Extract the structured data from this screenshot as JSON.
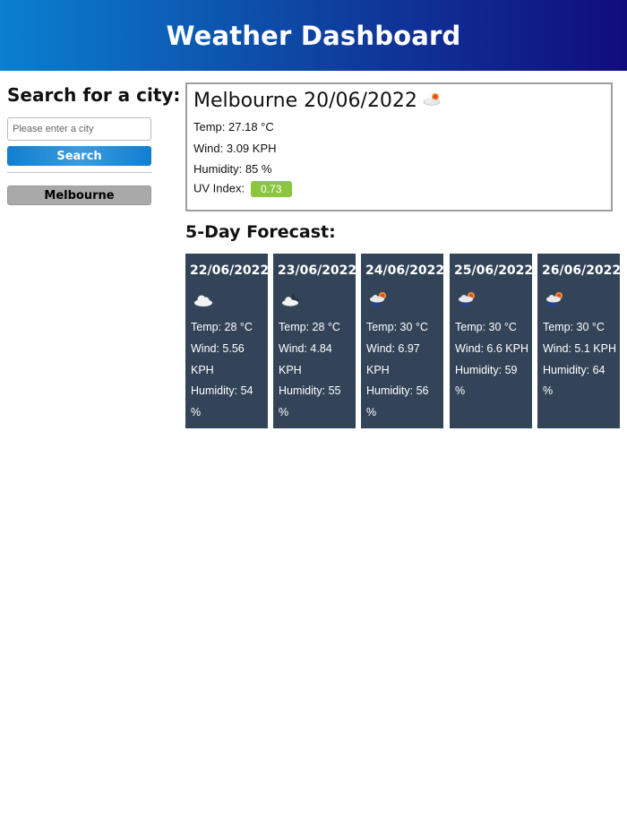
{
  "header": {
    "title": "Weather Dashboard"
  },
  "search": {
    "title": "Search for a city:",
    "placeholder": "Please enter a city",
    "value": "",
    "button_label": "Search"
  },
  "history": [
    {
      "label": "Melbourne"
    }
  ],
  "current": {
    "city_date": "Melbourne 20/06/2022",
    "icon": "partly-cloudy-sun-icon",
    "temp_label": "Temp:",
    "temp_value": "27.18 °C",
    "wind_label": "Wind:",
    "wind_value": "3.09 KPH",
    "humidity_label": "Humidity:",
    "humidity_value": "85 %",
    "uv_label": "UV Index:",
    "uv_value": "0.73",
    "uv_color": "#8cc63f"
  },
  "forecast": {
    "title": "5-Day Forecast:",
    "days": [
      {
        "date": "22/06/2022",
        "icon": "cloud-icon",
        "temp": "Temp: 28 °C",
        "wind": "Wind: 5.56 KPH",
        "humidity": "Humidity: 54 %"
      },
      {
        "date": "23/06/2022",
        "icon": "cloudy-night-icon",
        "temp": "Temp: 28 °C",
        "wind": "Wind: 4.84 KPH",
        "humidity": "Humidity: 55 %"
      },
      {
        "date": "24/06/2022",
        "icon": "rain-sun-icon",
        "temp": "Temp: 30 °C",
        "wind": "Wind: 6.97 KPH",
        "humidity": "Humidity: 56 %"
      },
      {
        "date": "25/06/2022",
        "icon": "rain-sun-icon",
        "temp": "Temp: 30 °C",
        "wind": "Wind: 6.6 KPH",
        "humidity": "Humidity: 59 %"
      },
      {
        "date": "26/06/2022",
        "icon": "rain-sun-icon",
        "temp": "Temp: 30 °C",
        "wind": "Wind: 5.1 KPH",
        "humidity": "Humidity: 64 %"
      }
    ]
  },
  "colors": {
    "header_gradient": [
      "#0a80cf",
      "#0e3d9d",
      "#110c7c"
    ],
    "card_bg": "#334459",
    "search_button": "#107fd0",
    "history_button": "#a9a9a9"
  }
}
